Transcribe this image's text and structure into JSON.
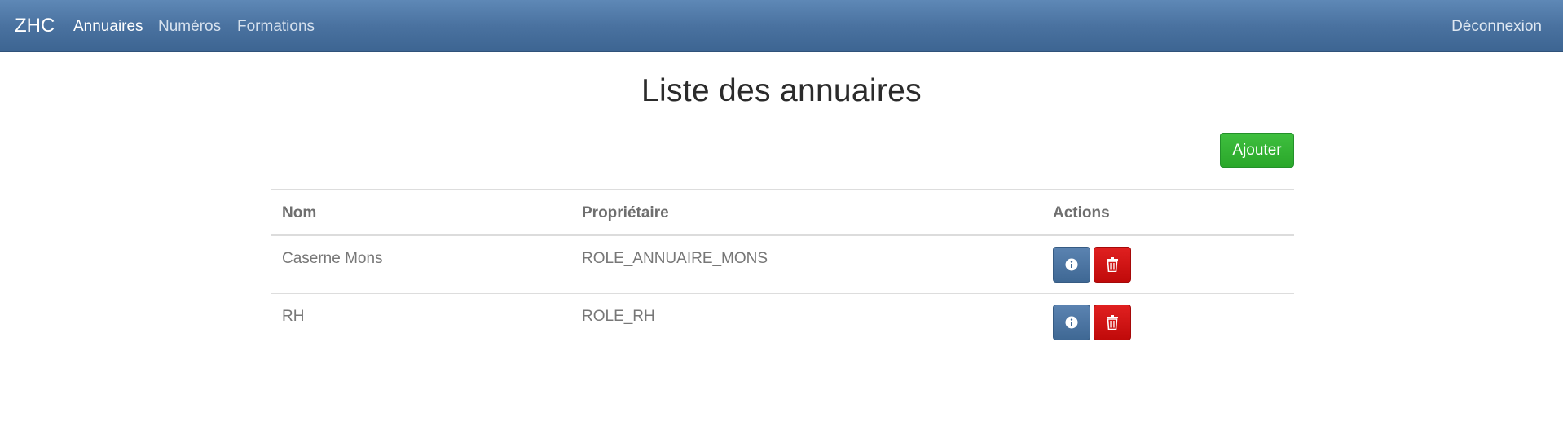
{
  "navbar": {
    "brand": "ZHC",
    "items": [
      {
        "label": "Annuaires",
        "active": true
      },
      {
        "label": "Numéros",
        "active": false
      },
      {
        "label": "Formations",
        "active": false
      }
    ],
    "logout_label": "Déconnexion"
  },
  "page": {
    "title": "Liste des annuaires",
    "add_label": "Ajouter"
  },
  "table": {
    "headers": [
      "Nom",
      "Propriétaire",
      "Actions"
    ],
    "rows": [
      {
        "nom": "Caserne Mons",
        "proprietaire": "ROLE_ANNUAIRE_MONS",
        "actions": [
          "info-icon",
          "trash-icon"
        ]
      },
      {
        "nom": "RH",
        "proprietaire": "ROLE_RH",
        "actions": [
          "info-icon",
          "trash-icon"
        ]
      }
    ]
  },
  "colors": {
    "navbar": "#4a72a0",
    "add_button": "#2aa72a",
    "info_button": "#4a72a0",
    "delete_button": "#cc1111"
  }
}
